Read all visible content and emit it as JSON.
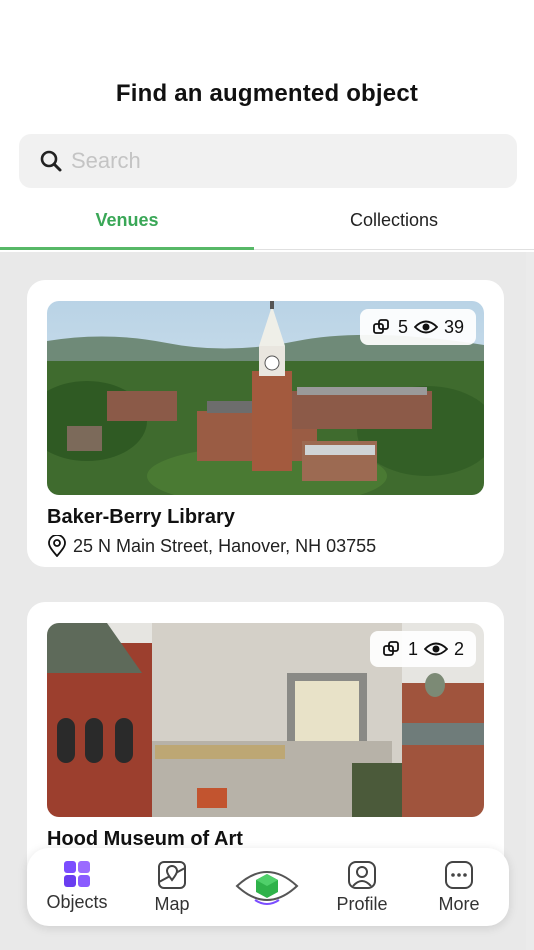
{
  "header": {
    "title": "Find an augmented object"
  },
  "search": {
    "placeholder": "Search",
    "value": "",
    "icon": "search-icon"
  },
  "tabs": [
    {
      "label": "Venues",
      "active": true
    },
    {
      "label": "Collections",
      "active": false
    }
  ],
  "venues": [
    {
      "name": "Baker-Berry Library",
      "address": "25 N Main Street, Hanover, NH 03755",
      "objects": "5",
      "views": "39",
      "image": "aerial photo of library with clock tower"
    },
    {
      "name": "Hood Museum of Art",
      "objects": "1",
      "views": "2",
      "image": "photo of museum facade with brick building"
    }
  ],
  "bottom_nav": {
    "items": [
      {
        "label": "Objects",
        "icon": "objects-grid-icon",
        "active": true
      },
      {
        "label": "Map",
        "icon": "map-icon",
        "active": false
      },
      {
        "label": "",
        "icon": "ar-eye-cube-icon",
        "active": false
      },
      {
        "label": "Profile",
        "icon": "profile-icon",
        "active": false
      },
      {
        "label": "More",
        "icon": "more-icon",
        "active": false
      }
    ]
  },
  "colors": {
    "accent_green": "#3aa757",
    "objects_purple": "#7b4dff",
    "content_bg": "#e9e9e9"
  }
}
